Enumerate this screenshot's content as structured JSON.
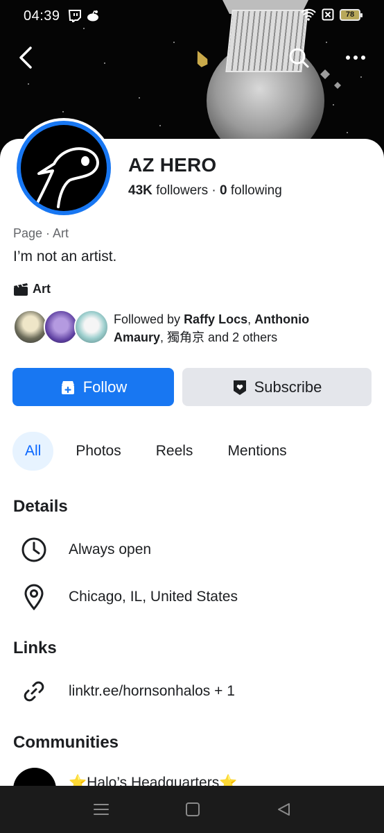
{
  "status_bar": {
    "time": "04:39",
    "battery": "78"
  },
  "profile": {
    "name": "AZ HERO",
    "followers_count": "43K",
    "followers_label": "followers",
    "separator": "·",
    "following_count": "0",
    "following_label": "following",
    "category": "Page · Art",
    "bio": "I’m not an artist.",
    "tag": "Art"
  },
  "mutuals": {
    "prefix": "Followed by ",
    "name1": "Raffy Locs",
    "sep1": ", ",
    "name2": "Anthonio Amaury",
    "sep2": ", ",
    "name3": "獨角京",
    "suffix": " and 2 others"
  },
  "actions": {
    "follow": "Follow",
    "subscribe": "Subscribe"
  },
  "tabs": [
    {
      "label": "All",
      "active": true
    },
    {
      "label": "Photos",
      "active": false
    },
    {
      "label": "Reels",
      "active": false
    },
    {
      "label": "Mentions",
      "active": false
    }
  ],
  "details": {
    "title": "Details",
    "hours": "Always open",
    "location": "Chicago, IL, United States"
  },
  "links": {
    "title": "Links",
    "url": "linktr.ee/hornsonhalos + 1"
  },
  "communities": {
    "title": "Communities",
    "first": "⭐Halo’s Headquarters⭐"
  },
  "colors": {
    "brand_blue": "#1877f2",
    "tab_active_bg": "#e7f3ff",
    "tab_active_text": "#0866ff",
    "secondary_btn": "#e4e6eb"
  },
  "icons": {
    "back": "back-arrow-icon",
    "search": "search-icon",
    "more": "more-dots-icon",
    "art": "clapperboard-icon",
    "follow": "follow-plus-icon",
    "subscribe": "subscribe-badge-icon",
    "clock": "clock-icon",
    "location": "location-pin-icon",
    "link": "link-icon"
  }
}
